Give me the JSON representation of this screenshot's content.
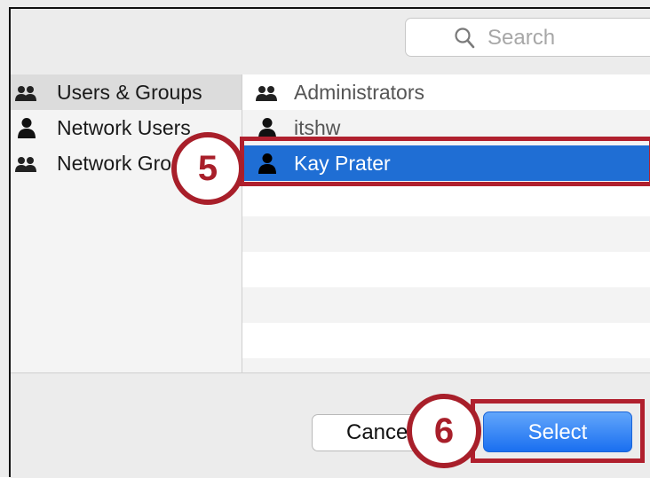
{
  "search": {
    "placeholder": "Search",
    "icon": "magnifier-icon"
  },
  "sidebar": {
    "items": [
      {
        "label": "Users & Groups",
        "icon": "group-icon",
        "selected": true
      },
      {
        "label": "Network Users",
        "icon": "user-icon",
        "selected": false
      },
      {
        "label": "Network Groups",
        "icon": "group-icon",
        "selected": false
      }
    ]
  },
  "list": {
    "rows": [
      {
        "label": "Administrators",
        "icon": "group-icon",
        "selected": false
      },
      {
        "label": "itshw",
        "icon": "user-icon",
        "selected": false
      },
      {
        "label": "Kay Prater",
        "icon": "user-icon",
        "selected": true
      }
    ]
  },
  "buttons": {
    "cancel": "Cancel",
    "select": "Select"
  },
  "callouts": {
    "step5": "5",
    "step6": "6"
  },
  "colors": {
    "selection": "#1f6ed4",
    "highlight": "#b0202e",
    "select_button": "#1a6ff0"
  }
}
